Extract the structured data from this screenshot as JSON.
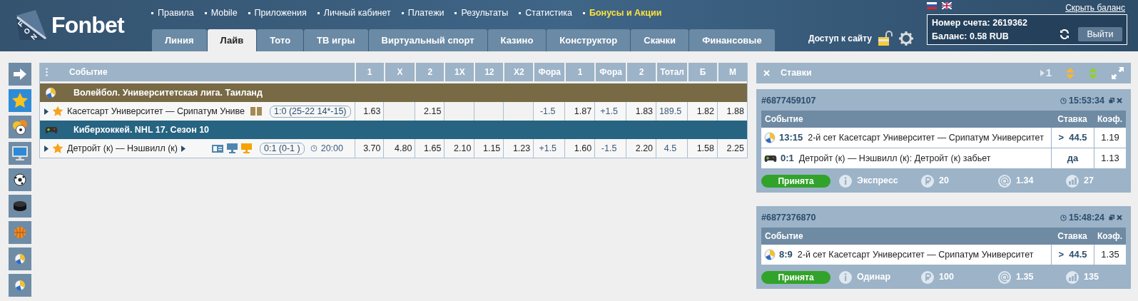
{
  "logo": {
    "letters": [
      "F",
      "O",
      "N"
    ],
    "name": "Fonbet"
  },
  "top_links": [
    {
      "label": "Правила",
      "highlighted": false
    },
    {
      "label": "Mobile",
      "highlighted": false
    },
    {
      "label": "Приложения",
      "highlighted": false
    },
    {
      "label": "Личный кабинет",
      "highlighted": false
    },
    {
      "label": "Платежи",
      "highlighted": false
    },
    {
      "label": "Результаты",
      "highlighted": false
    },
    {
      "label": "Статистика",
      "highlighted": false
    },
    {
      "label": "Бонусы и Акции",
      "highlighted": true
    }
  ],
  "tabs": [
    {
      "label": "Линия",
      "selected": false
    },
    {
      "label": "Лайв",
      "selected": true
    },
    {
      "label": "Тото",
      "selected": false
    },
    {
      "label": "ТВ игры",
      "selected": false
    },
    {
      "label": "Виртуальный спорт",
      "selected": false
    },
    {
      "label": "Казино",
      "selected": false
    },
    {
      "label": "Конструктор",
      "selected": false
    },
    {
      "label": "Скачки",
      "selected": false
    },
    {
      "label": "Финансовые",
      "selected": false
    }
  ],
  "site_access": "Доступ к сайту",
  "hide_balance": "Скрыть баланс",
  "account": {
    "number": "Номер счета: 2619362",
    "balance": "Баланс: 0.58 RUB",
    "logout": "Выйти"
  },
  "sidebar": [
    {
      "selected": false
    },
    {
      "selected": true
    },
    {
      "selected": false
    },
    {
      "selected": false
    },
    {
      "selected": false
    },
    {
      "selected": false
    },
    {
      "selected": false
    },
    {
      "selected": false
    },
    {
      "selected": false
    }
  ],
  "table": {
    "columns": [
      "Событие",
      "1",
      "X",
      "2",
      "1X",
      "12",
      "X2",
      "Фора",
      "1",
      "Фора",
      "2",
      "Тотал",
      "Б",
      "М"
    ],
    "groups": [
      {
        "title": "Волейбол. Университетская лига. Таиланд",
        "kind": "volleyball",
        "color": "#786a45",
        "rows": [
          {
            "expanded": false,
            "favorite": true,
            "teams": "Касетсарт Университет — Срипатум Униве",
            "kind": "scoreboard",
            "score": "1:0 (25-22 14*-15)",
            "odds": [
              {
                "value": "1.63"
              },
              {
                "blank": true
              },
              {
                "value": "2.15"
              },
              {
                "blank": true
              },
              {
                "blank": true
              },
              {
                "blank": true
              },
              {
                "value": "-1.5"
              },
              {
                "value": "1.87"
              },
              {
                "value": "+1.5"
              },
              {
                "value": "1.83"
              },
              {
                "value": "189.5"
              },
              {
                "value": "1.82"
              },
              {
                "value": "1.88"
              }
            ]
          }
        ]
      },
      {
        "title": "Киберхоккей. NHL 17. Сезон 10",
        "kind": "cyber",
        "color": "#266482",
        "rows": [
          {
            "expanded": false,
            "favorite": true,
            "teams": "Детройт (к) — Нэшвилл (к)",
            "kind": "tv",
            "score": "0:1 (0-1 )",
            "time": "20:00",
            "odds": [
              {
                "value": "3.70"
              },
              {
                "value": "4.80"
              },
              {
                "value": "1.65"
              },
              {
                "value": "2.10"
              },
              {
                "value": "1.15"
              },
              {
                "value": "1.23"
              },
              {
                "value": "+1.5"
              },
              {
                "value": "1.60"
              },
              {
                "value": "-1.5"
              },
              {
                "value": "2.20"
              },
              {
                "value": "4.5"
              },
              {
                "value": "1.58"
              },
              {
                "value": "2.25"
              }
            ]
          }
        ]
      }
    ]
  },
  "bets_panel": {
    "title": "Ставки",
    "counter": "1",
    "bets": [
      {
        "id": "#6877459107",
        "time": "15:53:34",
        "columns": [
          "Событие",
          "Ставка",
          "Коэф."
        ],
        "lines": [
          {
            "kind": "volleyball",
            "score": "13:15",
            "text": "2-й сет Касетсарт Университет — Срипатум Университет",
            "stake": ">  44.5",
            "coef": "1.19"
          },
          {
            "kind": "cyber",
            "score": "0:1",
            "text": "Детройт (к) — Нэшвилл (к): Детройт (к) забьет",
            "stake": "да",
            "coef": "1.13"
          }
        ],
        "status": "Принята",
        "type": "Экспресс",
        "amount": "20",
        "total_coef": "1.34",
        "payout": "27"
      },
      {
        "id": "#6877376870",
        "time": "15:48:24",
        "columns": [
          "Событие",
          "Ставка",
          "Коэф."
        ],
        "lines": [
          {
            "kind": "volleyball",
            "score": "8:9",
            "text": "2-й сет Касетсарт Университет — Срипатум Университет",
            "stake": ">  44.5",
            "coef": "1.35"
          }
        ],
        "status": "Принята",
        "type": "Одинар",
        "amount": "100",
        "total_coef": "1.35",
        "payout": "135"
      }
    ]
  }
}
